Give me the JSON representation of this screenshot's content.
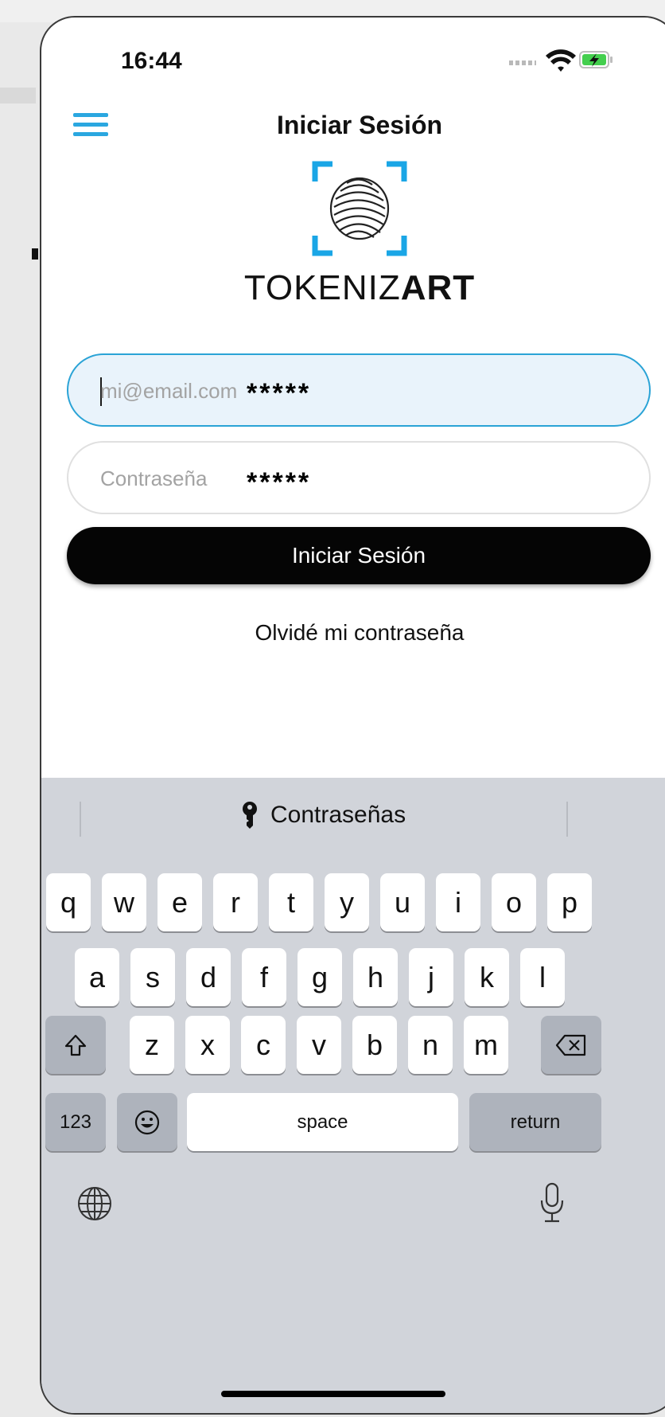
{
  "status_bar": {
    "time": "16:44"
  },
  "header": {
    "title": "Iniciar Sesión"
  },
  "brand": {
    "part1": "TOKENIZ",
    "part2": "ART"
  },
  "form": {
    "email_placeholder": "mi@email.com",
    "email_mask": "*****",
    "password_placeholder": "Contraseña",
    "password_mask": "*****",
    "login_label": "Iniciar Sesión",
    "forgot_label": "Olvidé mi contraseña"
  },
  "keyboard": {
    "suggestion": "Contraseñas",
    "row1": [
      "q",
      "w",
      "e",
      "r",
      "t",
      "y",
      "u",
      "i",
      "o",
      "p"
    ],
    "row2": [
      "a",
      "s",
      "d",
      "f",
      "g",
      "h",
      "j",
      "k",
      "l"
    ],
    "row3": [
      "z",
      "x",
      "c",
      "v",
      "b",
      "n",
      "m"
    ],
    "numbers_label": "123",
    "space_label": "space",
    "return_label": "return"
  },
  "colors": {
    "accent": "#2aa7e0",
    "button": "#050505",
    "keyboard_bg": "#d1d4da"
  }
}
